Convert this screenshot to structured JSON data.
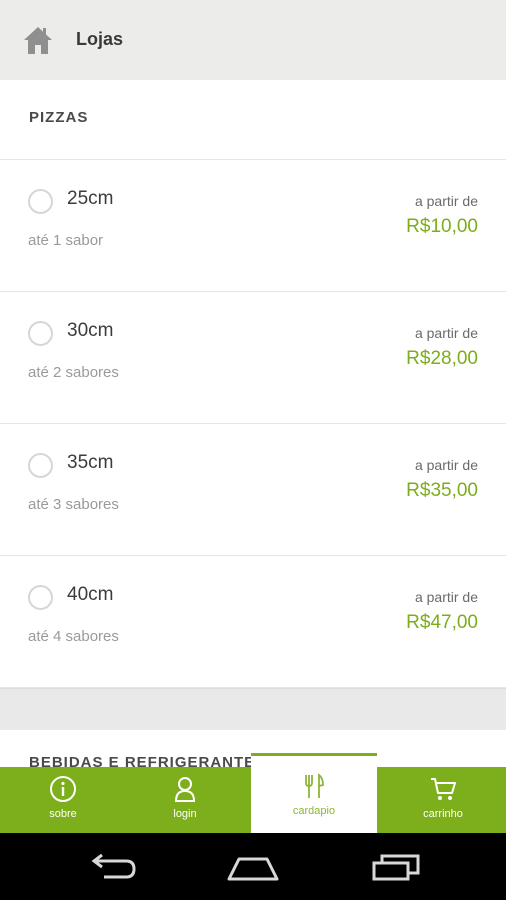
{
  "topbar": {
    "title": "Lojas",
    "icon": "home-icon"
  },
  "section": {
    "title": "PIZZAS"
  },
  "items": [
    {
      "size": "25cm",
      "flavors": "até 1 sabor",
      "price_prefix": "a partir de",
      "price": "R$10,00"
    },
    {
      "size": "30cm",
      "flavors": "até 2 sabores",
      "price_prefix": "a partir de",
      "price": "R$28,00"
    },
    {
      "size": "35cm",
      "flavors": "até 3 sabores",
      "price_prefix": "a partir de",
      "price": "R$35,00"
    },
    {
      "size": "40cm",
      "flavors": "até 4 sabores",
      "price_prefix": "a partir de",
      "price": "R$47,00"
    }
  ],
  "next_section": {
    "title": "BEBIDAS E REFRIGERANTES"
  },
  "nav": [
    {
      "label": "sobre",
      "icon": "info-icon"
    },
    {
      "label": "login",
      "icon": "user-icon"
    },
    {
      "label": "cardapio",
      "icon": "fork-knife-icon",
      "active": true
    },
    {
      "label": "carrinho",
      "icon": "cart-icon"
    }
  ],
  "colors": {
    "accent": "#7dae1b",
    "price": "#7cad1a",
    "topbar": "#ececea"
  }
}
